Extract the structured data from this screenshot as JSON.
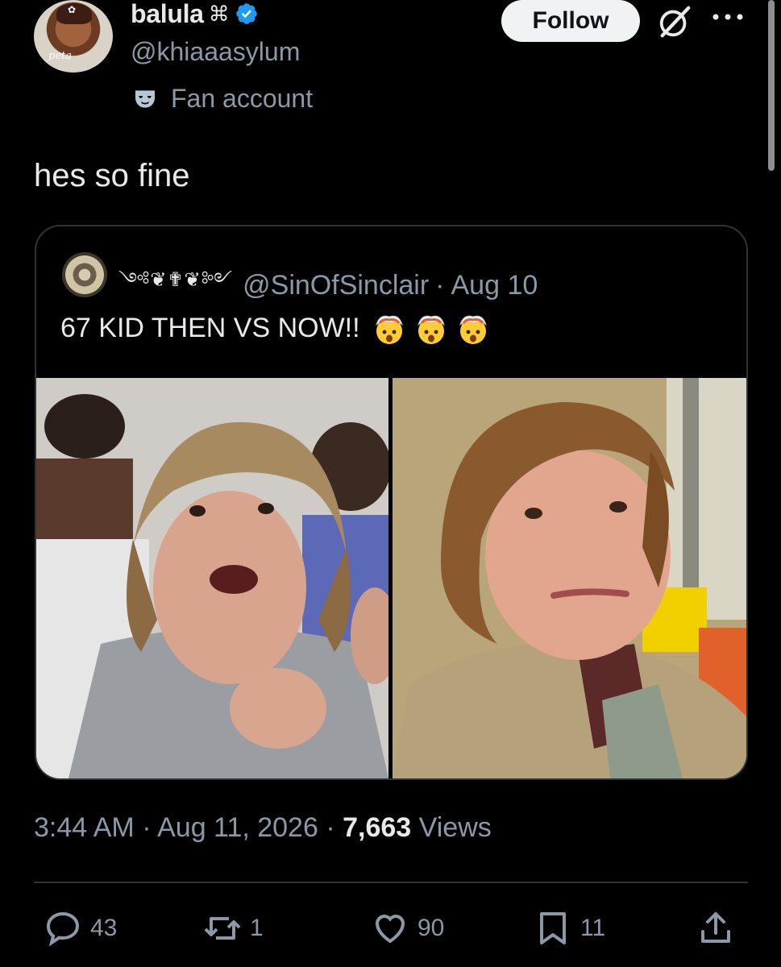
{
  "user": {
    "display_name": "balula",
    "name_glyph": "⌘",
    "handle": "@khiaaasylum",
    "label": "Fan account",
    "avatar_signature": "peta"
  },
  "header": {
    "follow_label": "Follow"
  },
  "tweet": {
    "text": "hes so fine",
    "timestamp": "3:44 AM",
    "date": "Aug 11, 2026",
    "views_count": "7,663",
    "views_label": "Views"
  },
  "quote": {
    "display_name": "༺❦✟❦༻",
    "handle": "@SinOfSinclair",
    "date": "Aug 10",
    "text": "67 KID THEN VS NOW!!",
    "separator": "·"
  },
  "actions": {
    "replies": "43",
    "reposts": "1",
    "likes": "90",
    "bookmarks": "11"
  },
  "colors": {
    "background": "#000000",
    "primary_text": "#e7e9ea",
    "secondary_text": "#8b98a5",
    "verified_blue": "#1d9bf0",
    "border": "#2f3336"
  },
  "icons": {
    "verified": "verified-badge-icon",
    "label": "fan-account-mask-icon",
    "grok": "grok-icon",
    "more": "more-dots-icon",
    "reply": "reply-icon",
    "repost": "repost-icon",
    "like": "heart-icon",
    "bookmark": "bookmark-icon",
    "share": "share-icon"
  }
}
